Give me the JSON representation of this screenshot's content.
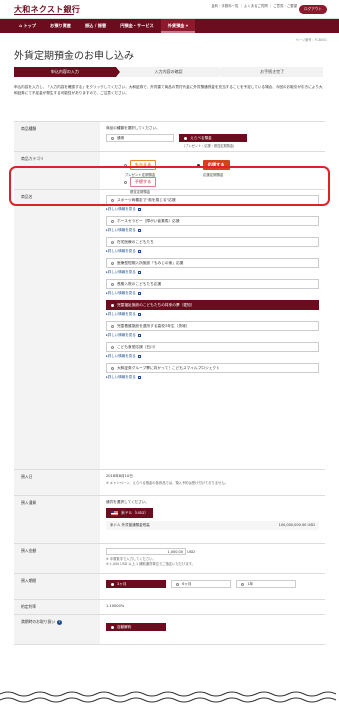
{
  "header": {
    "logo": "大和ネクスト銀行",
    "links_line1": "金利・手数料一覧 ｜ よくあるご質問 ｜ ご意見・ご要望",
    "links_line2": "",
    "logout": "ログアウト"
  },
  "nav": {
    "items": [
      {
        "label": "⌂ トップ"
      },
      {
        "label": "お預り資産"
      },
      {
        "label": "振込 / 振替"
      },
      {
        "label": "円預金・サービス"
      },
      {
        "label": "外貨預金 ▾"
      }
    ]
  },
  "page_no": "ページ番号：FCB001",
  "title": "外貨定期預金のお申し込み",
  "steps": [
    "申込内容の入力",
    "入力内容の確認",
    "お手続き完了"
  ],
  "intro": "申込内容を入力し、「入力内容を確認する」をクリックしてください。大和証券で、外貨建て商品の買付代金に外貨預通資金を充当することを予定している場合、今回のお取引が引きにより大和証券にて不足金が発生する可能性がありますので、ご注意ください。",
  "shohin_shurui": {
    "label": "商品種類",
    "hint": "商品の種類を選択してください。",
    "options": [
      "通常",
      "えらべる預金"
    ],
    "selected_index": 1,
    "sub": "(プレゼント・応援・懸賞定期預金)"
  },
  "category": {
    "label": "商品カテゴリ",
    "options": [
      {
        "tag": "もらえる",
        "caption": "プレゼント定期預金",
        "color": "#e88b2c",
        "selected": false
      },
      {
        "tag": "応援する",
        "caption": "応援定期預金",
        "color": "#d6401e",
        "selected": true
      },
      {
        "tag": "予想する",
        "caption": "懸賞定期預金",
        "color": "#e07a8a",
        "selected": false
      }
    ]
  },
  "products": {
    "label": "商品名",
    "more_label": "▸詳しい情報を見る",
    "items": [
      {
        "name": "スポーツ両義定で\"風を感じる\"応援",
        "selected": false
      },
      {
        "name": "ホースセラピー（障がい者乗馬）応援",
        "selected": false
      },
      {
        "name": "在宅医療のこどもたち",
        "selected": false
      },
      {
        "name": "医療型短期入所施設「もみじの家」応援",
        "selected": false
      },
      {
        "name": "長期入院のこどもたち応援",
        "selected": false
      },
      {
        "name": "児童福祉施設のこどもたちの将来の夢（愛知）",
        "selected": true
      },
      {
        "name": "児童養護施設を退所する高校3年生（茨城）",
        "selected": false
      },
      {
        "name": "こども食堂応援（石川）",
        "selected": false
      },
      {
        "name": "大和証券グループ夢に向かって！こどもスマイルプロジェクト",
        "selected": false
      }
    ]
  },
  "yoyaku": {
    "label": "預入日",
    "value": "2018年8月10日",
    "note": "※ キャンペーン、えらべる預金の各商品では、預入予約は受け付けておりません。"
  },
  "currency": {
    "label": "預入通貨",
    "hint": "通貨を選択してください。",
    "selected": "米ドル（USD）",
    "info_left": "米ドル 外貨普通預金残高",
    "info_right": "100,000,000.00 USD"
  },
  "amount": {
    "label": "預入金額",
    "value": "1,000.00",
    "unit": "USD",
    "note1": "※ 半角数字で入力してください。",
    "note2": "※ 1,000 USD 以上 1 補助通貨単位でご指定いただけます。"
  },
  "period": {
    "label": "預入期間",
    "options": [
      "3ヶ月",
      "6ヶ月",
      "1年"
    ],
    "selected_index": 0
  },
  "rate": {
    "label": "約定利率",
    "value": "1.10000%"
  },
  "maturity": {
    "label": "満期時のお取り扱い",
    "selected": "自動解約"
  }
}
